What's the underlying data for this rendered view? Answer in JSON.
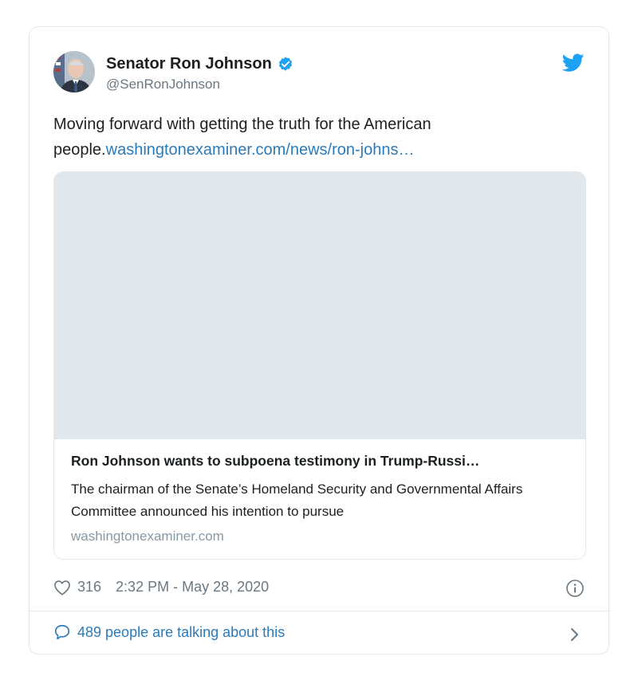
{
  "author": {
    "name": "Senator Ron Johnson",
    "handle": "@SenRonJohnson",
    "verified": true
  },
  "tweet": {
    "text_prefix": "Moving forward with getting the truth for the American people.",
    "link_text": "washingtonexaminer.com/news/ron-johns…"
  },
  "link_card": {
    "title": "Ron Johnson wants to subpoena testimony in Trump-Russi…",
    "description": "The chairman of the Senate’s Homeland Security and Governmental Affairs Committee announced his intention to pursue",
    "domain": "washingtonexaminer.com"
  },
  "meta": {
    "likes": "316",
    "timestamp": "2:32 PM - May 28, 2020"
  },
  "footer": {
    "talking": "489 people are talking about this"
  },
  "colors": {
    "link": "#2b7bb9",
    "twitter_blue": "#1da1f2",
    "muted": "#697882",
    "border": "#e1e8ed"
  },
  "icons": [
    "verified-badge-icon",
    "twitter-bird-icon",
    "heart-icon",
    "info-icon",
    "speech-bubble-icon",
    "chevron-right-icon"
  ]
}
